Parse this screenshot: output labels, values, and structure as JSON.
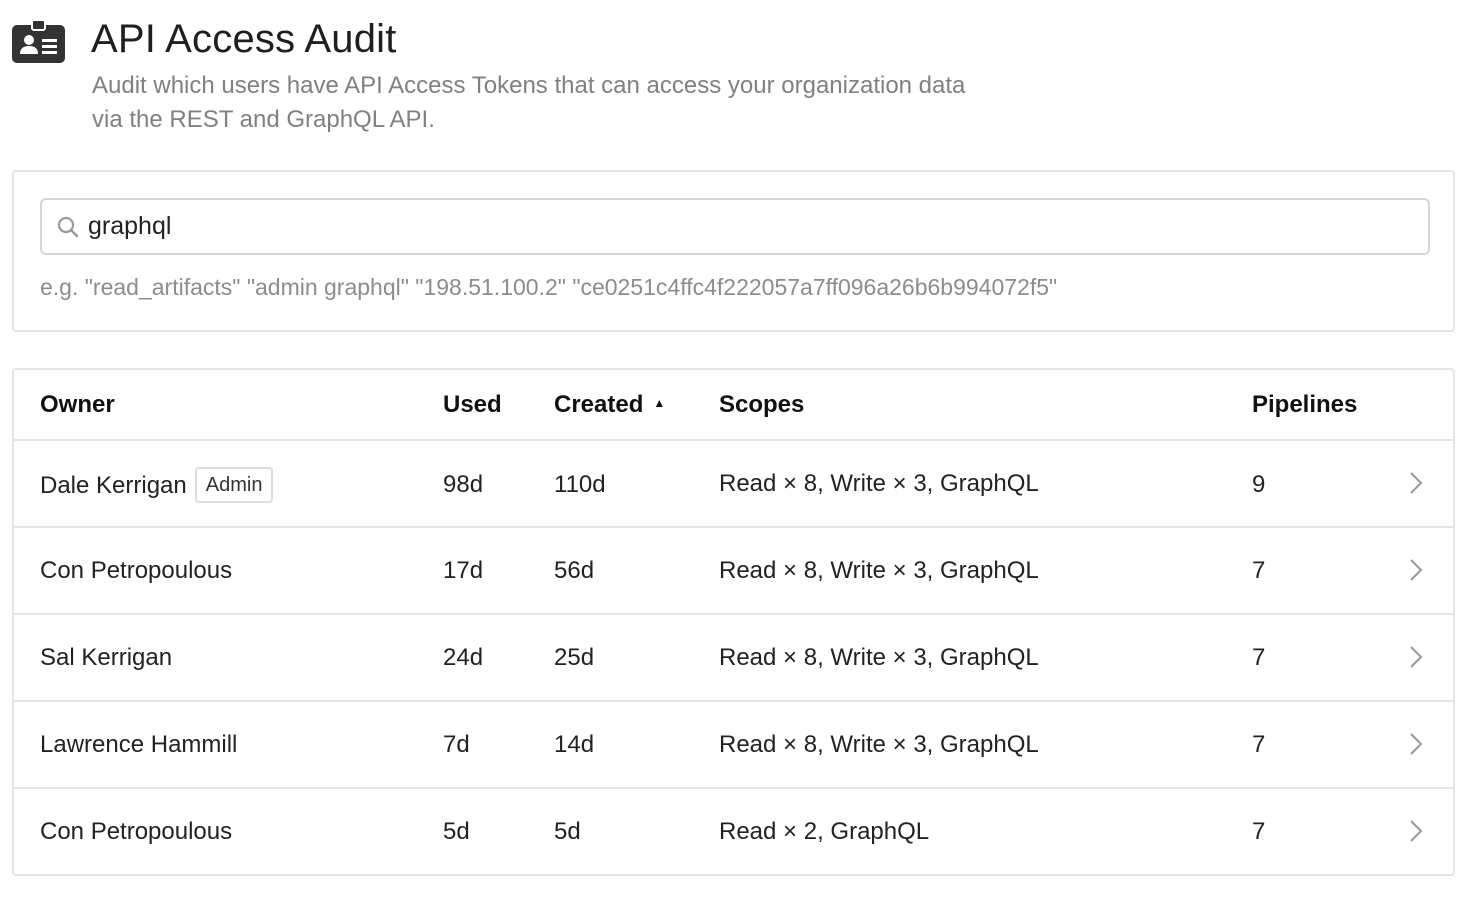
{
  "header": {
    "icon": "id-card-icon",
    "title": "API Access Audit",
    "description": "Audit which users have API Access Tokens that can access your organization data via the REST and GraphQL API."
  },
  "search": {
    "value": "graphql",
    "hint": "e.g. \"read_artifacts\" \"admin graphql\" \"198.51.100.2\" \"ce0251c4ffc4f222057a7ff096a26b6b994072f5\""
  },
  "table": {
    "columns": {
      "owner": "Owner",
      "used": "Used",
      "created": "Created",
      "scopes": "Scopes",
      "pipelines": "Pipelines"
    },
    "rows": [
      {
        "owner": "Dale Kerrigan",
        "badge": "Admin",
        "used": "98d",
        "created": "110d",
        "scopes": "Read × 8, Write × 3, GraphQL",
        "pipelines": "9"
      },
      {
        "owner": "Con Petropoulous",
        "used": "17d",
        "created": "56d",
        "scopes": "Read × 8, Write × 3, GraphQL",
        "pipelines": "7"
      },
      {
        "owner": "Sal Kerrigan",
        "used": "24d",
        "created": "25d",
        "scopes": "Read × 8, Write × 3, GraphQL",
        "pipelines": "7"
      },
      {
        "owner": "Lawrence Hammill",
        "used": "7d",
        "created": "14d",
        "scopes": "Read × 8, Write × 3, GraphQL",
        "pipelines": "7"
      },
      {
        "owner": "Con Petropoulous",
        "used": "5d",
        "created": "5d",
        "scopes": "Read × 2, GraphQL",
        "pipelines": "7"
      }
    ]
  }
}
